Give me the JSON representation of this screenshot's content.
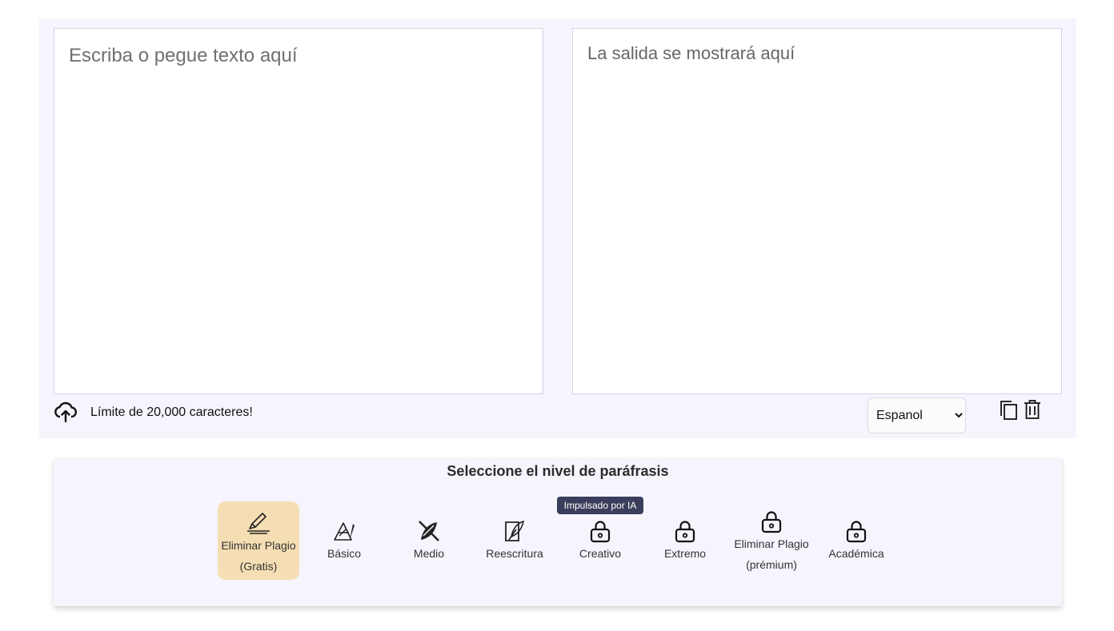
{
  "editor": {
    "input_placeholder": "Escriba o pegue texto aquí",
    "output_placeholder": "La salida se mostrará aquí",
    "char_limit": "Límite de 20,000 caracteres!",
    "language": {
      "selected": "Espanol",
      "options": [
        "Espanol"
      ]
    },
    "icons": {
      "upload": "cloud-upload-icon",
      "copy": "copy-icon",
      "delete": "trash-icon"
    }
  },
  "levels": {
    "title": "Seleccione el nivel de paráfrasis",
    "ai_badge": "Impulsado por IA",
    "active_color": "#f5deb3",
    "items": [
      {
        "line1": "Eliminar Plagio",
        "line2": "(Gratis)",
        "icon": "pen-icon",
        "active": true
      },
      {
        "line1": "Básico",
        "icon": "triangle-quill-icon"
      },
      {
        "line1": "Medio",
        "icon": "quill-ink-icon"
      },
      {
        "line1": "Reescritura",
        "icon": "document-quill-icon"
      },
      {
        "line1": "Creativo",
        "icon": "lock-icon"
      },
      {
        "line1": "Extremo",
        "icon": "lock-icon"
      },
      {
        "line1": "Eliminar Plagio",
        "line2": "(prémium)",
        "icon": "lock-icon"
      },
      {
        "line1": "Académica",
        "icon": "lock-icon"
      }
    ]
  }
}
